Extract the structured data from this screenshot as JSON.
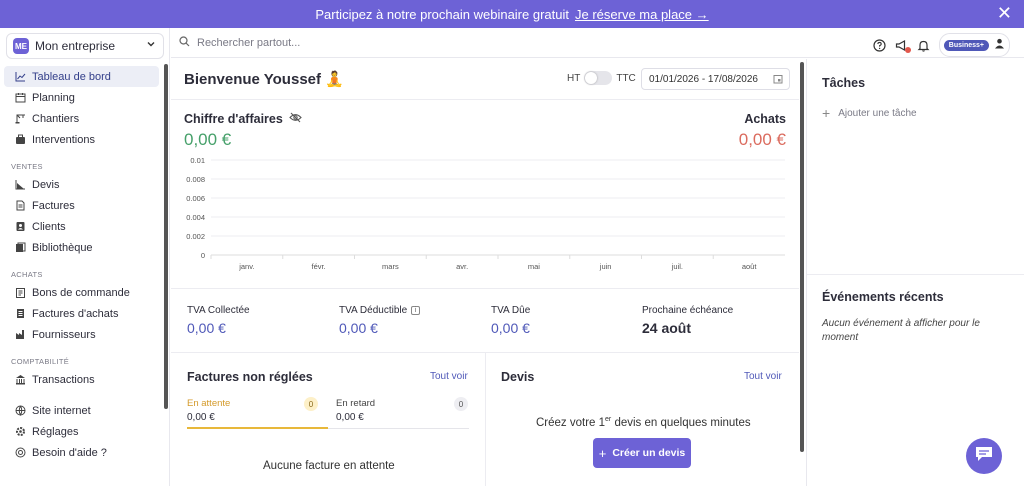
{
  "banner": {
    "text": "Participez à notre prochain webinaire gratuit",
    "cta": "Je réserve ma place →",
    "close": "✕"
  },
  "sidebar": {
    "company": {
      "initials": "ME",
      "name": "Mon entreprise"
    },
    "items": [
      {
        "label": "Tableau de bord",
        "icon": "chart-line-icon",
        "active": true
      },
      {
        "label": "Planning",
        "icon": "calendar-icon"
      },
      {
        "label": "Chantiers",
        "icon": "crane-icon"
      },
      {
        "label": "Interventions",
        "icon": "briefcase-icon"
      }
    ],
    "sections": [
      {
        "title": "VENTES",
        "items": [
          {
            "label": "Devis",
            "icon": "chart-area-icon"
          },
          {
            "label": "Factures",
            "icon": "document-icon"
          },
          {
            "label": "Clients",
            "icon": "contacts-icon"
          },
          {
            "label": "Bibliothèque",
            "icon": "library-icon"
          }
        ]
      },
      {
        "title": "ACHATS",
        "items": [
          {
            "label": "Bons de commande",
            "icon": "clipboard-icon"
          },
          {
            "label": "Factures d'achats",
            "icon": "receipt-icon"
          },
          {
            "label": "Fournisseurs",
            "icon": "factory-icon"
          }
        ]
      },
      {
        "title": "COMPTABILITÉ",
        "items": [
          {
            "label": "Transactions",
            "icon": "bank-icon"
          }
        ]
      }
    ],
    "footer": [
      {
        "label": "Site internet",
        "icon": "globe-icon"
      },
      {
        "label": "Réglages",
        "icon": "gear-icon"
      },
      {
        "label": "Besoin d'aide ?",
        "icon": "help-icon"
      }
    ]
  },
  "topbar": {
    "search_placeholder": "Rechercher partout...",
    "plan": "Business+"
  },
  "main": {
    "welcome": "Bienvenue Youssef 🧘",
    "toggle_left": "HT",
    "toggle_right": "TTC",
    "date_range": "01/01/2026 - 17/08/2026",
    "revenue_label": "Chiffre d'affaires",
    "revenue_value": "0,00 €",
    "purchases_label": "Achats",
    "purchases_value": "0,00 €",
    "kpis": [
      {
        "label": "TVA Collectée",
        "value": "0,00 €"
      },
      {
        "label": "TVA Déductible",
        "value": "0,00 €",
        "info": "i"
      },
      {
        "label": "TVA Dûe",
        "value": "0,00 €"
      },
      {
        "label": "Prochaine échéance",
        "value": "24 août"
      }
    ],
    "invoices": {
      "title": "Factures non réglées",
      "link": "Tout voir",
      "pending_label": "En attente",
      "pending_count": "0",
      "pending_value": "0,00 €",
      "late_label": "En retard",
      "late_count": "0",
      "late_value": "0,00 €",
      "empty": "Aucune facture en attente"
    },
    "quotes": {
      "title": "Devis",
      "link": "Tout voir",
      "empty_pre": "Créez votre 1",
      "empty_sup": "er",
      "empty_post": " devis en quelques minutes",
      "button": "Créer un devis"
    }
  },
  "right": {
    "tasks_title": "Tâches",
    "add_task": "Ajouter une tâche",
    "events_title": "Événements récents",
    "events_empty": "Aucun événement à afficher pour le moment"
  },
  "colors": {
    "accent": "#6d62d6",
    "revenue": "#46a06a",
    "purchases": "#db6b5e",
    "link": "#4f58b8"
  },
  "chart_data": {
    "type": "bar",
    "categories": [
      "janv.",
      "févr.",
      "mars",
      "avr.",
      "mai",
      "juin",
      "juil.",
      "août"
    ],
    "series": [
      {
        "values": [
          0,
          0,
          0,
          0,
          0,
          0,
          0,
          0
        ]
      },
      {
        "values": [
          0,
          0,
          0,
          0,
          0,
          0,
          0,
          0
        ]
      }
    ],
    "yticks": [
      "0",
      "0.002",
      "0.004",
      "0.006",
      "0.008",
      "0.01"
    ],
    "ylim": [
      0,
      0.01
    ],
    "grid": true
  }
}
